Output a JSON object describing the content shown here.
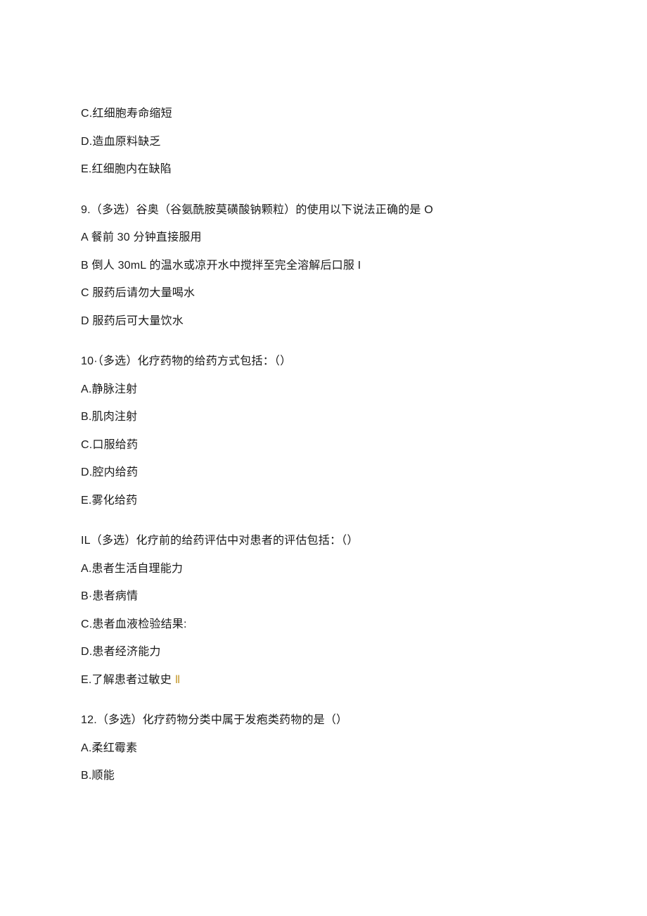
{
  "block1": {
    "optC": "C.红细胞寿命缩短",
    "optD": "D.造血原料缺乏",
    "optE": "E.红细胞内在缺陷"
  },
  "q9": {
    "stem": "9.（多选）谷奥（谷氨酰胺莫磺酸钠颗粒）的使用以下说法正确的是 O",
    "optA": "A 餐前 30 分钟直接服用",
    "optB": "B 倒人 30mL 的温水或凉开水中搅拌至完全溶解后口服 I",
    "optC": "C 服药后请勿大量喝水",
    "optD": "D 服药后可大量饮水"
  },
  "q10": {
    "stem": "10·（多选）化疗药物的给药方式包括：（）",
    "optA": "A.静脉注射",
    "optB": "B.肌肉注射",
    "optC": "C.口服给药",
    "optD": "D.腔内给药",
    "optE": "E.雾化给药"
  },
  "q11": {
    "stem": "IL（多选）化疗前的给药评估中对患者的评估包括：（）",
    "optA": "A.患者生活自理能力",
    "optB": "B·患者病情",
    "optC": "C.患者血液检验结果:",
    "optD": "D.患者经济能力",
    "optE_pre": "E.了解患者过敏史 ",
    "optE_hl": "Ⅱ"
  },
  "q12": {
    "stem": "12.（多选）化疗药物分类中属于发疱类药物的是（）",
    "optA": "A.柔红霉素",
    "optB": "B.顺能"
  }
}
